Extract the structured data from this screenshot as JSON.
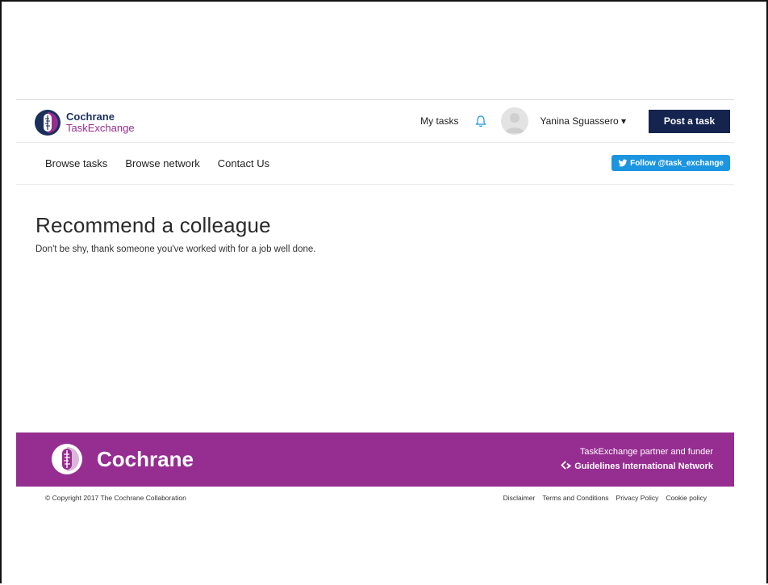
{
  "brand": {
    "line1": "Cochrane",
    "line2": "TaskExchange",
    "purple": "#962d91",
    "navy": "#14244f"
  },
  "header": {
    "my_tasks": "My tasks",
    "user_name": "Yanina Sguassero ▾",
    "post_task": "Post a task"
  },
  "nav": {
    "items": [
      "Browse tasks",
      "Browse network",
      "Contact Us"
    ],
    "twitter_follow": "Follow @task_exchange"
  },
  "main": {
    "title": "Recommend a colleague",
    "subtitle": "Don't be shy, thank someone you've worked with for a job well done."
  },
  "footer": {
    "brand_name": "Cochrane",
    "partner_label": "TaskExchange partner and funder",
    "partner_name": "Guidelines International Network",
    "copyright": "© Copyright 2017 The Cochrane Collaboration",
    "links": [
      "Disclaimer",
      "Terms and Conditions",
      "Privacy Policy",
      "Cookie policy"
    ]
  }
}
